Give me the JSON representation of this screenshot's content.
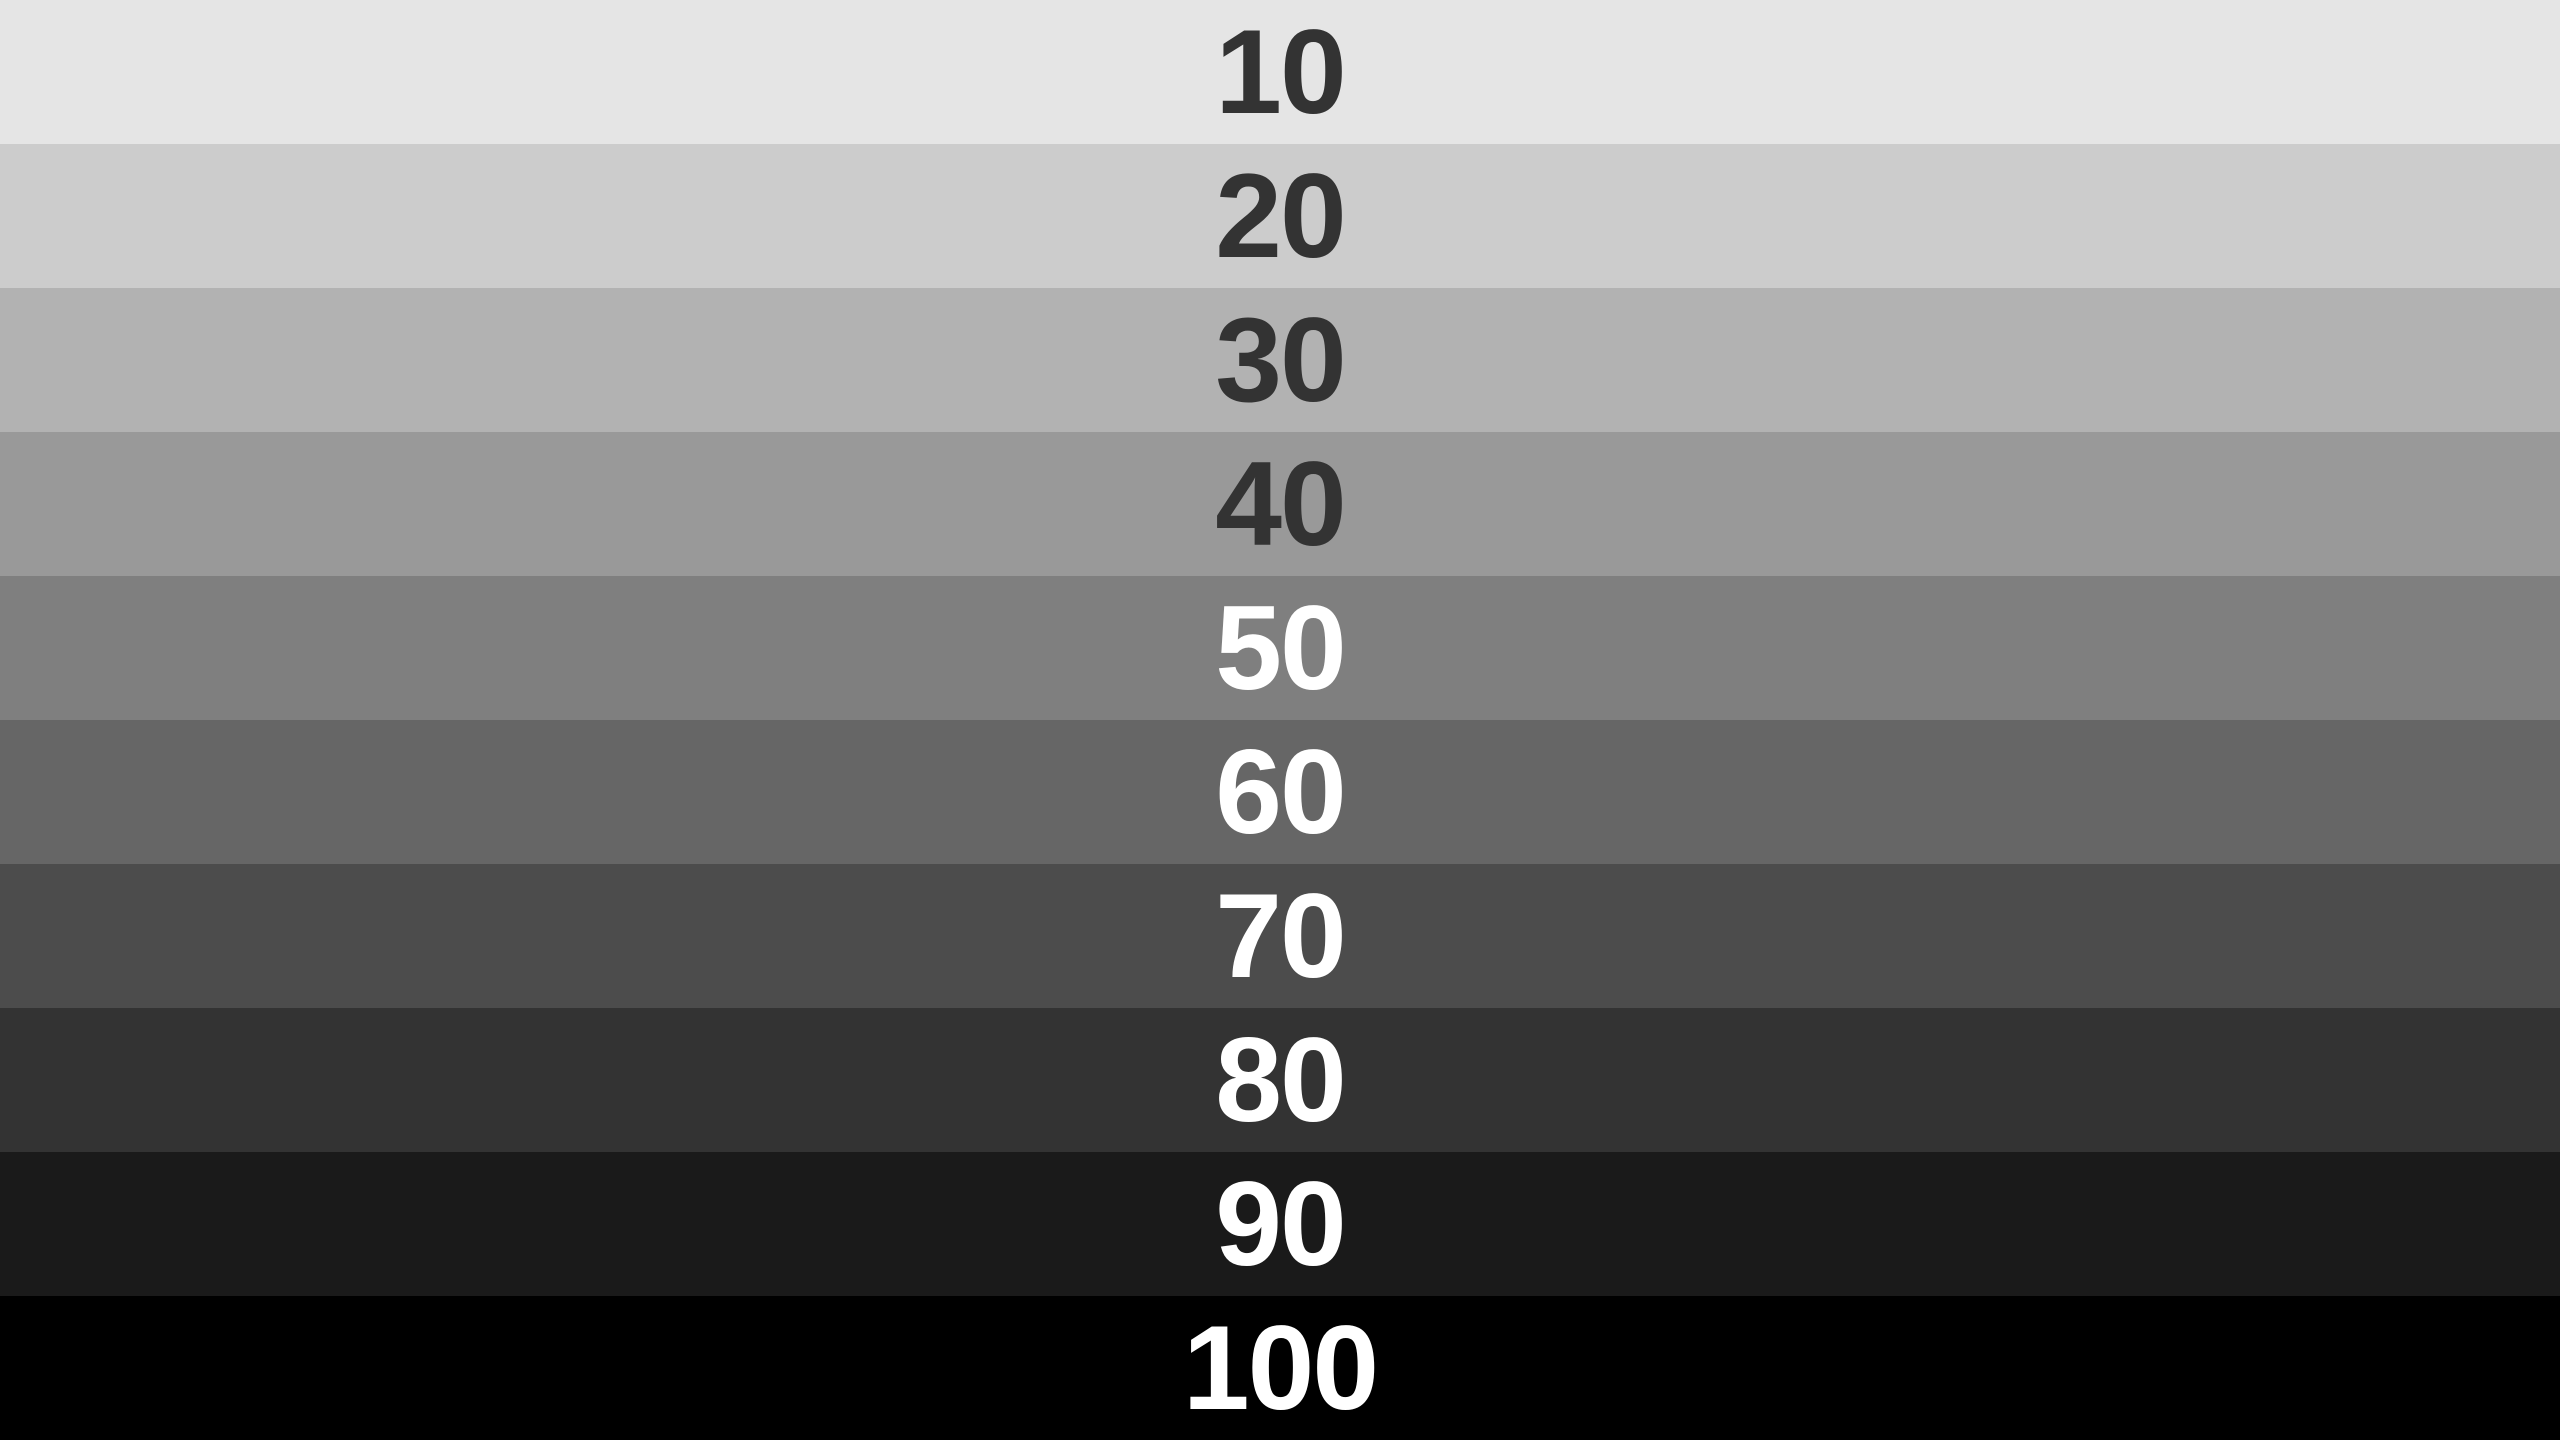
{
  "swatches": [
    {
      "label": "10",
      "bg": "#e5e5e5",
      "fg": "#333333"
    },
    {
      "label": "20",
      "bg": "#cccccc",
      "fg": "#333333"
    },
    {
      "label": "30",
      "bg": "#b2b2b2",
      "fg": "#333333"
    },
    {
      "label": "40",
      "bg": "#999999",
      "fg": "#333333"
    },
    {
      "label": "50",
      "bg": "#7f7f7f",
      "fg": "#ffffff"
    },
    {
      "label": "60",
      "bg": "#666666",
      "fg": "#ffffff"
    },
    {
      "label": "70",
      "bg": "#4c4c4c",
      "fg": "#ffffff"
    },
    {
      "label": "80",
      "bg": "#333333",
      "fg": "#ffffff"
    },
    {
      "label": "90",
      "bg": "#1a1a1a",
      "fg": "#ffffff"
    },
    {
      "label": "100",
      "bg": "#000000",
      "fg": "#ffffff"
    }
  ]
}
